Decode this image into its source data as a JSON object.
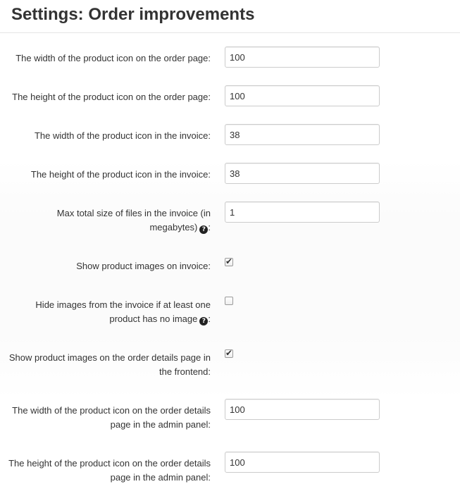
{
  "header": {
    "title": "Settings: Order improvements"
  },
  "settings": {
    "order_icon_width": {
      "label": "The width of the product icon on the order page:",
      "value": "100"
    },
    "order_icon_height": {
      "label": "The height of the product icon on the order page:",
      "value": "100"
    },
    "invoice_icon_width": {
      "label": "The width of the product icon in the invoice:",
      "value": "38"
    },
    "invoice_icon_height": {
      "label": "The height of the product icon in the invoice:",
      "value": "38"
    },
    "max_invoice_files_size": {
      "label_line1": "Max total size of files in the invoice (in",
      "label_line2": "megabytes)",
      "label_suffix": ":",
      "value": "1",
      "has_help_icon": true
    },
    "show_invoice_images": {
      "label": "Show product images on invoice:",
      "checked": true
    },
    "hide_invoice_images": {
      "label_line1": "Hide images from the invoice if at least one",
      "label_line2": "product has no image",
      "label_suffix": ":",
      "checked": false,
      "has_help_icon": true
    },
    "show_frontend_images": {
      "label_line1": "Show product images on the order details page in",
      "label_line2": "the frontend:",
      "checked": true
    },
    "admin_icon_width": {
      "label_line1": "The width of the product icon on the order details",
      "label_line2": "page in the admin panel:",
      "value": "100"
    },
    "admin_icon_height": {
      "label_line1": "The height of the product icon on the order details",
      "label_line2": "page in the admin panel:",
      "value": "100"
    }
  },
  "icons": {
    "help": "question-circle-icon",
    "check": "checkmark-icon"
  },
  "colors": {
    "text": "#333333",
    "border": "#cccccc",
    "help_icon": "#222222"
  }
}
